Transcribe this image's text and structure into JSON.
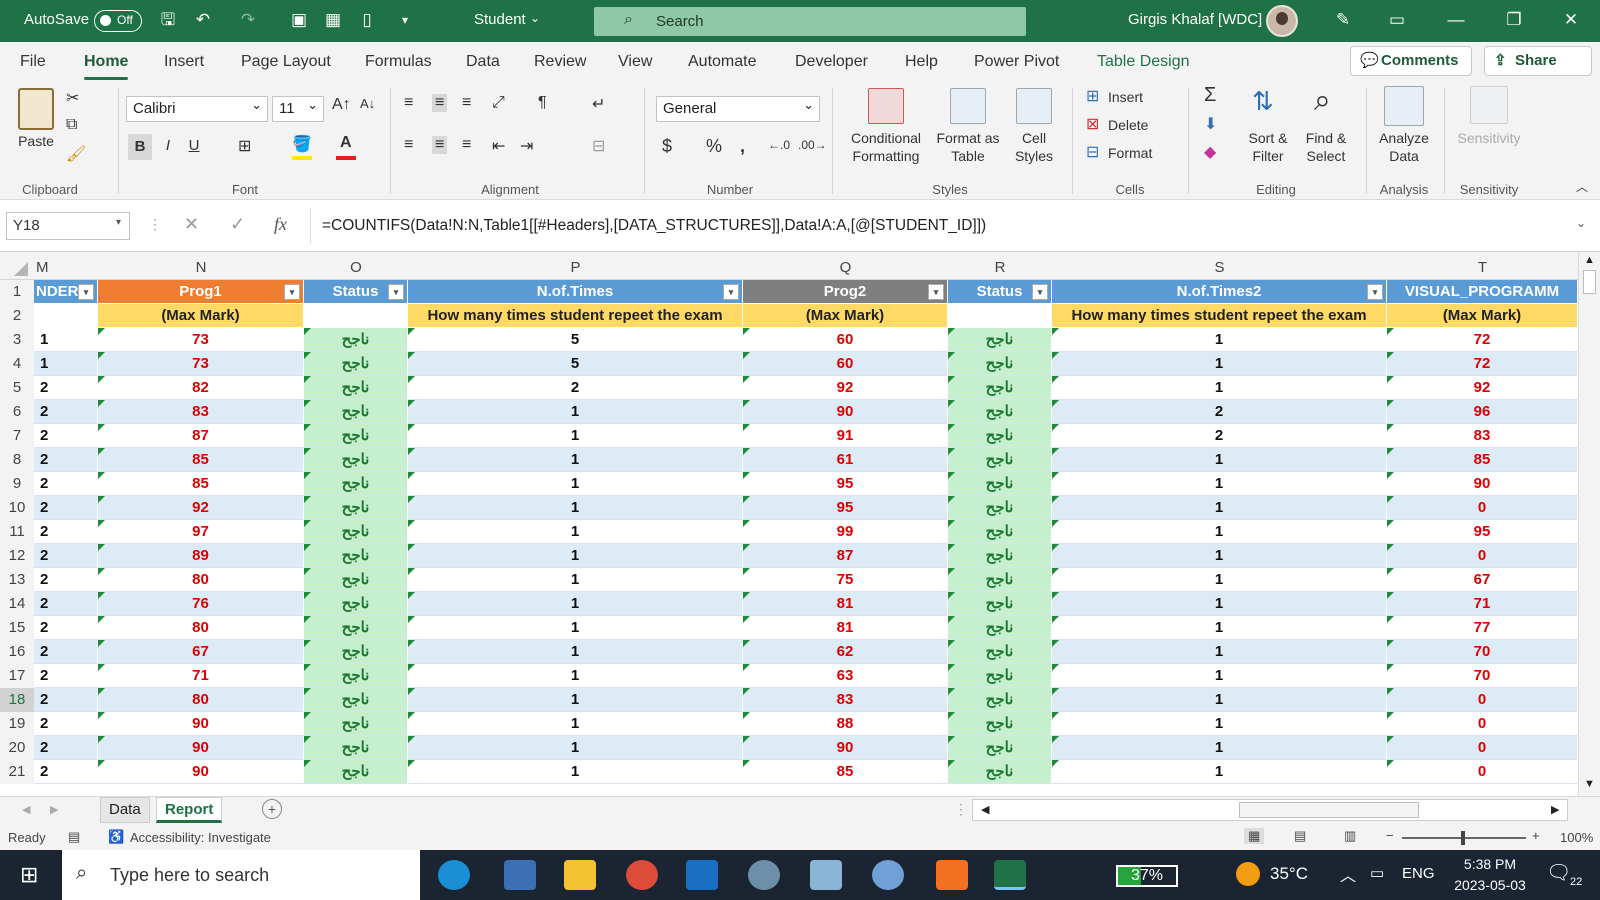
{
  "titlebar": {
    "autosave_label": "AutoSave",
    "autosave_state": "Off",
    "doc_title": "Student",
    "search_placeholder": "Search",
    "user": "Girgis Khalaf [WDC]"
  },
  "menu": {
    "tabs": [
      "File",
      "Home",
      "Insert",
      "Page Layout",
      "Formulas",
      "Data",
      "Review",
      "View",
      "Automate",
      "Developer",
      "Help",
      "Power Pivot",
      "Table Design"
    ],
    "active_tab": "Home",
    "comments": "Comments",
    "share": "Share"
  },
  "ribbon": {
    "clipboard": {
      "paste": "Paste",
      "group": "Clipboard"
    },
    "font": {
      "name": "Calibri",
      "size": "11",
      "group": "Font",
      "bold": "B",
      "italic": "I",
      "underline": "U"
    },
    "alignment": {
      "group": "Alignment"
    },
    "number": {
      "format": "General",
      "group": "Number",
      "currency": "$",
      "percent": "%"
    },
    "styles": {
      "conditional": "Conditional",
      "conditional2": "Formatting",
      "format_table": "Format as",
      "format_table2": "Table",
      "cell_styles": "Cell",
      "cell_styles2": "Styles",
      "group": "Styles"
    },
    "cells": {
      "insert": "Insert",
      "delete": "Delete",
      "format": "Format",
      "group": "Cells"
    },
    "editing": {
      "sort": "Sort &",
      "sort2": "Filter",
      "find": "Find &",
      "find2": "Select",
      "group": "Editing"
    },
    "analysis": {
      "analyze": "Analyze",
      "analyze2": "Data",
      "group": "Analysis"
    },
    "sensitivity": {
      "label": "Sensitivity",
      "group": "Sensitivity"
    },
    "colors": {
      "font_red": "#e02020",
      "highlight_yellow": "#ffe900"
    }
  },
  "formula_bar": {
    "name_box": "Y18",
    "fx": "fx",
    "formula": "=COUNTIFS(Data!N:N,Table1[[#Headers],[DATA_STRUCTURES]],Data!A:A,[@[STUDENT_ID]])"
  },
  "grid": {
    "columns": [
      {
        "letter": "M",
        "header": "NDER",
        "sub": "",
        "kind": "m"
      },
      {
        "letter": "N",
        "header": "Prog1",
        "sub": "(Max Mark)",
        "kind": "prog1"
      },
      {
        "letter": "O",
        "header": "Status",
        "sub": "",
        "kind": "status"
      },
      {
        "letter": "P",
        "header": "N.of.Times",
        "sub": "How many times student repeet the exam",
        "kind": "times"
      },
      {
        "letter": "Q",
        "header": "Prog2",
        "sub": "(Max Mark)",
        "kind": "prog2"
      },
      {
        "letter": "R",
        "header": "Status",
        "sub": "",
        "kind": "status"
      },
      {
        "letter": "S",
        "header": "N.of.Times2",
        "sub": "How many times student repeet the exam",
        "kind": "times"
      },
      {
        "letter": "T",
        "header": "VISUAL_PROGRAMM",
        "sub": "(Max Mark)",
        "kind": "visual"
      }
    ],
    "row_numbers": [
      "1",
      "2",
      "3",
      "4",
      "5",
      "6",
      "7",
      "8",
      "9",
      "10",
      "11",
      "12",
      "13",
      "14",
      "15",
      "16",
      "17",
      "18",
      "19",
      "20",
      "21"
    ],
    "selected_row": "18",
    "status_text": "ناجح",
    "rows": [
      [
        "1",
        "73",
        "ناجح",
        "5",
        "60",
        "ناجح",
        "1",
        "72"
      ],
      [
        "1",
        "73",
        "ناجح",
        "5",
        "60",
        "ناجح",
        "1",
        "72"
      ],
      [
        "2",
        "82",
        "ناجح",
        "2",
        "92",
        "ناجح",
        "1",
        "92"
      ],
      [
        "2",
        "83",
        "ناجح",
        "1",
        "90",
        "ناجح",
        "2",
        "96"
      ],
      [
        "2",
        "87",
        "ناجح",
        "1",
        "91",
        "ناجح",
        "2",
        "83"
      ],
      [
        "2",
        "85",
        "ناجح",
        "1",
        "61",
        "ناجح",
        "1",
        "85"
      ],
      [
        "2",
        "85",
        "ناجح",
        "1",
        "95",
        "ناجح",
        "1",
        "90"
      ],
      [
        "2",
        "92",
        "ناجح",
        "1",
        "95",
        "ناجح",
        "1",
        "0"
      ],
      [
        "2",
        "97",
        "ناجح",
        "1",
        "99",
        "ناجح",
        "1",
        "95"
      ],
      [
        "2",
        "89",
        "ناجح",
        "1",
        "87",
        "ناجح",
        "1",
        "0"
      ],
      [
        "2",
        "80",
        "ناجح",
        "1",
        "75",
        "ناجح",
        "1",
        "67"
      ],
      [
        "2",
        "76",
        "ناجح",
        "1",
        "81",
        "ناجح",
        "1",
        "71"
      ],
      [
        "2",
        "80",
        "ناجح",
        "1",
        "81",
        "ناجح",
        "1",
        "77"
      ],
      [
        "2",
        "67",
        "ناجح",
        "1",
        "62",
        "ناجح",
        "1",
        "70"
      ],
      [
        "2",
        "71",
        "ناجح",
        "1",
        "63",
        "ناجح",
        "1",
        "70"
      ],
      [
        "2",
        "80",
        "ناجح",
        "1",
        "83",
        "ناجح",
        "1",
        "0"
      ],
      [
        "2",
        "90",
        "ناجح",
        "1",
        "88",
        "ناجح",
        "1",
        "0"
      ],
      [
        "2",
        "90",
        "ناجح",
        "1",
        "90",
        "ناجح",
        "1",
        "0"
      ],
      [
        "2",
        "90",
        "ناجح",
        "1",
        "85",
        "ناجح",
        "1",
        "0"
      ]
    ],
    "colors": {
      "prog1_header": "#ef7d31",
      "prog2_header": "#7f7f7f",
      "blue_header": "#5b9bd5",
      "sub_header": "#ffd966",
      "status_fill": "#c6efce",
      "status_text": "#1a7a2e",
      "mark_red": "#e00000",
      "band_blue": "#ddebf7"
    }
  },
  "sheets": {
    "tabs": [
      "Data",
      "Report"
    ],
    "active": "Report"
  },
  "status": {
    "ready": "Ready",
    "accessibility": "Accessibility: Investigate",
    "zoom": "100%"
  },
  "taskbar": {
    "search": "Type here to search",
    "battery": "37%",
    "temp": "35°C",
    "lang": "ENG",
    "time": "5:38 PM",
    "date": "2023-05-03",
    "notifications": "22"
  }
}
